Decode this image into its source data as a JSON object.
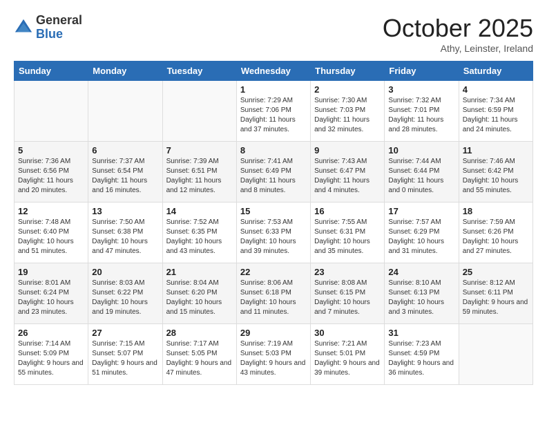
{
  "header": {
    "logo_general": "General",
    "logo_blue": "Blue",
    "month": "October 2025",
    "location": "Athy, Leinster, Ireland"
  },
  "days_of_week": [
    "Sunday",
    "Monday",
    "Tuesday",
    "Wednesday",
    "Thursday",
    "Friday",
    "Saturday"
  ],
  "weeks": [
    [
      {
        "day": "",
        "sunrise": "",
        "sunset": "",
        "daylight": ""
      },
      {
        "day": "",
        "sunrise": "",
        "sunset": "",
        "daylight": ""
      },
      {
        "day": "",
        "sunrise": "",
        "sunset": "",
        "daylight": ""
      },
      {
        "day": "1",
        "sunrise": "Sunrise: 7:29 AM",
        "sunset": "Sunset: 7:06 PM",
        "daylight": "Daylight: 11 hours and 37 minutes."
      },
      {
        "day": "2",
        "sunrise": "Sunrise: 7:30 AM",
        "sunset": "Sunset: 7:03 PM",
        "daylight": "Daylight: 11 hours and 32 minutes."
      },
      {
        "day": "3",
        "sunrise": "Sunrise: 7:32 AM",
        "sunset": "Sunset: 7:01 PM",
        "daylight": "Daylight: 11 hours and 28 minutes."
      },
      {
        "day": "4",
        "sunrise": "Sunrise: 7:34 AM",
        "sunset": "Sunset: 6:59 PM",
        "daylight": "Daylight: 11 hours and 24 minutes."
      }
    ],
    [
      {
        "day": "5",
        "sunrise": "Sunrise: 7:36 AM",
        "sunset": "Sunset: 6:56 PM",
        "daylight": "Daylight: 11 hours and 20 minutes."
      },
      {
        "day": "6",
        "sunrise": "Sunrise: 7:37 AM",
        "sunset": "Sunset: 6:54 PM",
        "daylight": "Daylight: 11 hours and 16 minutes."
      },
      {
        "day": "7",
        "sunrise": "Sunrise: 7:39 AM",
        "sunset": "Sunset: 6:51 PM",
        "daylight": "Daylight: 11 hours and 12 minutes."
      },
      {
        "day": "8",
        "sunrise": "Sunrise: 7:41 AM",
        "sunset": "Sunset: 6:49 PM",
        "daylight": "Daylight: 11 hours and 8 minutes."
      },
      {
        "day": "9",
        "sunrise": "Sunrise: 7:43 AM",
        "sunset": "Sunset: 6:47 PM",
        "daylight": "Daylight: 11 hours and 4 minutes."
      },
      {
        "day": "10",
        "sunrise": "Sunrise: 7:44 AM",
        "sunset": "Sunset: 6:44 PM",
        "daylight": "Daylight: 11 hours and 0 minutes."
      },
      {
        "day": "11",
        "sunrise": "Sunrise: 7:46 AM",
        "sunset": "Sunset: 6:42 PM",
        "daylight": "Daylight: 10 hours and 55 minutes."
      }
    ],
    [
      {
        "day": "12",
        "sunrise": "Sunrise: 7:48 AM",
        "sunset": "Sunset: 6:40 PM",
        "daylight": "Daylight: 10 hours and 51 minutes."
      },
      {
        "day": "13",
        "sunrise": "Sunrise: 7:50 AM",
        "sunset": "Sunset: 6:38 PM",
        "daylight": "Daylight: 10 hours and 47 minutes."
      },
      {
        "day": "14",
        "sunrise": "Sunrise: 7:52 AM",
        "sunset": "Sunset: 6:35 PM",
        "daylight": "Daylight: 10 hours and 43 minutes."
      },
      {
        "day": "15",
        "sunrise": "Sunrise: 7:53 AM",
        "sunset": "Sunset: 6:33 PM",
        "daylight": "Daylight: 10 hours and 39 minutes."
      },
      {
        "day": "16",
        "sunrise": "Sunrise: 7:55 AM",
        "sunset": "Sunset: 6:31 PM",
        "daylight": "Daylight: 10 hours and 35 minutes."
      },
      {
        "day": "17",
        "sunrise": "Sunrise: 7:57 AM",
        "sunset": "Sunset: 6:29 PM",
        "daylight": "Daylight: 10 hours and 31 minutes."
      },
      {
        "day": "18",
        "sunrise": "Sunrise: 7:59 AM",
        "sunset": "Sunset: 6:26 PM",
        "daylight": "Daylight: 10 hours and 27 minutes."
      }
    ],
    [
      {
        "day": "19",
        "sunrise": "Sunrise: 8:01 AM",
        "sunset": "Sunset: 6:24 PM",
        "daylight": "Daylight: 10 hours and 23 minutes."
      },
      {
        "day": "20",
        "sunrise": "Sunrise: 8:03 AM",
        "sunset": "Sunset: 6:22 PM",
        "daylight": "Daylight: 10 hours and 19 minutes."
      },
      {
        "day": "21",
        "sunrise": "Sunrise: 8:04 AM",
        "sunset": "Sunset: 6:20 PM",
        "daylight": "Daylight: 10 hours and 15 minutes."
      },
      {
        "day": "22",
        "sunrise": "Sunrise: 8:06 AM",
        "sunset": "Sunset: 6:18 PM",
        "daylight": "Daylight: 10 hours and 11 minutes."
      },
      {
        "day": "23",
        "sunrise": "Sunrise: 8:08 AM",
        "sunset": "Sunset: 6:15 PM",
        "daylight": "Daylight: 10 hours and 7 minutes."
      },
      {
        "day": "24",
        "sunrise": "Sunrise: 8:10 AM",
        "sunset": "Sunset: 6:13 PM",
        "daylight": "Daylight: 10 hours and 3 minutes."
      },
      {
        "day": "25",
        "sunrise": "Sunrise: 8:12 AM",
        "sunset": "Sunset: 6:11 PM",
        "daylight": "Daylight: 9 hours and 59 minutes."
      }
    ],
    [
      {
        "day": "26",
        "sunrise": "Sunrise: 7:14 AM",
        "sunset": "Sunset: 5:09 PM",
        "daylight": "Daylight: 9 hours and 55 minutes."
      },
      {
        "day": "27",
        "sunrise": "Sunrise: 7:15 AM",
        "sunset": "Sunset: 5:07 PM",
        "daylight": "Daylight: 9 hours and 51 minutes."
      },
      {
        "day": "28",
        "sunrise": "Sunrise: 7:17 AM",
        "sunset": "Sunset: 5:05 PM",
        "daylight": "Daylight: 9 hours and 47 minutes."
      },
      {
        "day": "29",
        "sunrise": "Sunrise: 7:19 AM",
        "sunset": "Sunset: 5:03 PM",
        "daylight": "Daylight: 9 hours and 43 minutes."
      },
      {
        "day": "30",
        "sunrise": "Sunrise: 7:21 AM",
        "sunset": "Sunset: 5:01 PM",
        "daylight": "Daylight: 9 hours and 39 minutes."
      },
      {
        "day": "31",
        "sunrise": "Sunrise: 7:23 AM",
        "sunset": "Sunset: 4:59 PM",
        "daylight": "Daylight: 9 hours and 36 minutes."
      },
      {
        "day": "",
        "sunrise": "",
        "sunset": "",
        "daylight": ""
      }
    ]
  ]
}
